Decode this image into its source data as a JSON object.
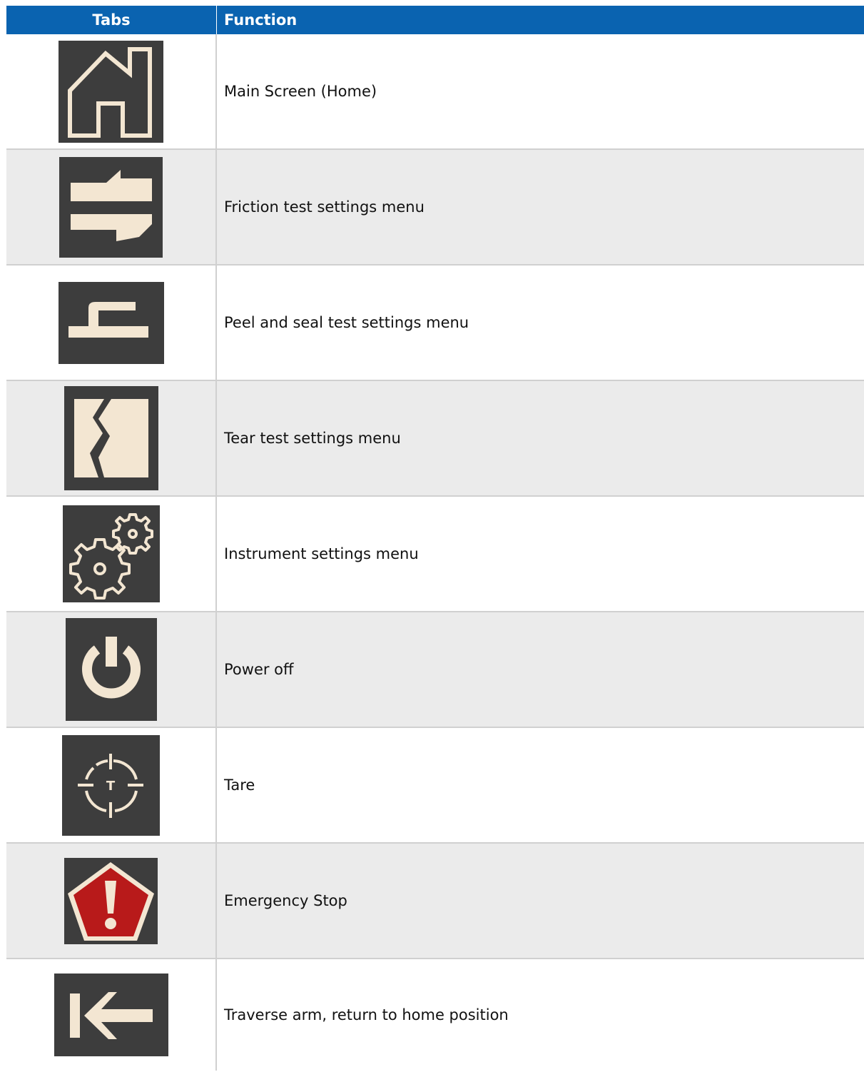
{
  "header": {
    "col_tabs": "Tabs",
    "col_function": "Function"
  },
  "rows": [
    {
      "icon": "home-icon",
      "function": "Main Screen (Home)"
    },
    {
      "icon": "friction-test-icon",
      "function": "Friction test settings menu"
    },
    {
      "icon": "peel-seal-test-icon",
      "function": "Peel and seal test settings menu"
    },
    {
      "icon": "tear-test-icon",
      "function": "Tear test settings menu"
    },
    {
      "icon": "gears-icon",
      "function": "Instrument settings menu"
    },
    {
      "icon": "power-icon",
      "function": "Power off"
    },
    {
      "icon": "tare-icon",
      "function": "Tare"
    },
    {
      "icon": "emergency-stop-icon",
      "function": "Emergency Stop"
    },
    {
      "icon": "return-home-arrow-icon",
      "function": "Traverse arm, return to home position"
    }
  ],
  "colors": {
    "header_bg": "#0a63b0",
    "icon_bg": "#3d3d3d",
    "icon_fg": "#f3e6d2",
    "alert_red": "#b81a1a",
    "row_alt_bg": "#ebebeb"
  }
}
